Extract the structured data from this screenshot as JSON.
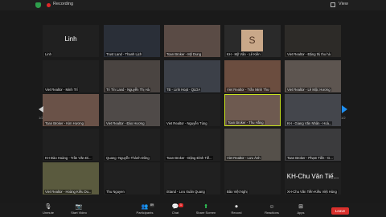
{
  "topbar": {
    "recording": "Recording",
    "view": "View"
  },
  "tiles": [
    {
      "name": "Linh",
      "big": "Linh",
      "bg": "#202020"
    },
    {
      "name": "Trust Land - Thanh Lịch",
      "bg": "#2a2f38"
    },
    {
      "name": "Toan Broker - Mỹ Dung",
      "bg": "#5a4b45"
    },
    {
      "name": "KH - Mỹ Vân - Lê Kiên",
      "avatar": "S",
      "bg": "#2a2a2a"
    },
    {
      "name": "Viet Realtor - Đặng thị thu hà",
      "bg": "#2d2b28"
    },
    {
      "name": "Viet Realtor - Minh Trí",
      "bg": "#202020"
    },
    {
      "name": "Tri Tín Land - Nguyễn Thị Hà",
      "bg": "#4a4441"
    },
    {
      "name": "TB - Linh Hoạt - QLDA",
      "bg": "#3c4048"
    },
    {
      "name": "Viet Realtor - Trần Minh Thư",
      "bg": "#6b4d3f"
    },
    {
      "name": "Viet Realtor - Lê Mộc Hương",
      "bg": "#5d5550"
    },
    {
      "name": "Toan Broker - Kim Hương",
      "bg": "#6a5248"
    },
    {
      "name": "Viet Realtor - Đào Hương",
      "bg": "#4f4a48"
    },
    {
      "name": "Viet Realtor - Nguyễn Tùng",
      "bg": "#202020"
    },
    {
      "name": "Toan Broker - Thu Hằng",
      "bg": "#6e5a50",
      "selected": true
    },
    {
      "name": "KH - Giang Văn Nhân - Hoà...",
      "bg": "#44464c"
    },
    {
      "name": "KH Đào Hoàng - Trần Văn Đi...",
      "bg": "#202020"
    },
    {
      "name": "Quang -Nguyễn Thành Đông",
      "bg": "#202020"
    },
    {
      "name": "Toan Broker - Đặng Đình Tiế...",
      "bg": "#202020"
    },
    {
      "name": "Viet Realtor - Lưu Ánh",
      "bg": "#55504a"
    },
    {
      "name": "Toan Broker - Phạm Tiến - G...",
      "bg": "#3b3b3d"
    },
    {
      "name": "Viet Realtor - Hoàng Kiều Du...",
      "bg": "#5a5a3e"
    },
    {
      "name": "Thu Nguyen",
      "bg": "#202020"
    },
    {
      "name": "iStand - Lưu Xuân Quang",
      "bg": "#202020"
    },
    {
      "name": "Bảo Việt Nghị",
      "bg": "#202020"
    },
    {
      "name": "XH-Chu Văn Tiến-Kiều Việt Hùng",
      "big": "KH-Chu Văn Tiế...",
      "bg": "#202020"
    }
  ],
  "pager": {
    "left": "1/2",
    "right": "1/2"
  },
  "toolbar": [
    {
      "label": "Unmute",
      "icon": "🎙"
    },
    {
      "label": "Start Video",
      "icon": "📷"
    },
    {
      "label": "Participants",
      "icon": "👥"
    },
    {
      "label": "Chat",
      "icon": "💬"
    },
    {
      "label": "Share Screen",
      "icon": "⬆"
    },
    {
      "label": "Record",
      "icon": "⏺"
    },
    {
      "label": "Reactions",
      "icon": "☺"
    },
    {
      "label": "Apps",
      "icon": "⊞"
    }
  ],
  "counts": {
    "participants": "89",
    "chat": "1"
  },
  "leave": "Leave"
}
